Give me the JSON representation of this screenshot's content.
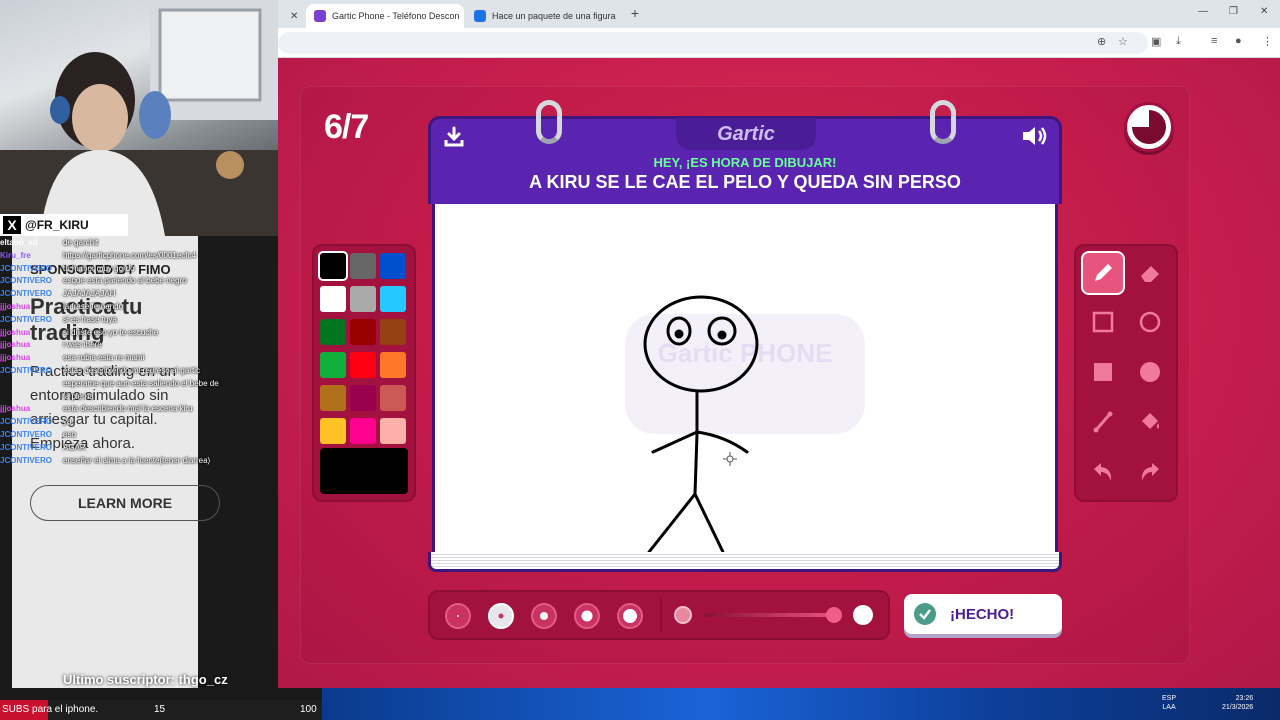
{
  "browser": {
    "tabs": [
      {
        "title": "Gartic Phone - Teléfono Descon",
        "active": true
      },
      {
        "title": "Hace un paquete de una figura",
        "active": false
      }
    ]
  },
  "game": {
    "round": "6/7",
    "logo": "Gartic",
    "prompt_subtitle": "HEY, ¡ES HORA DE DIBUJAR!",
    "prompt_text": "A KIRU SE LE CAE EL PELO Y QUEDA SIN PERSO",
    "done_label": "¡HECHO!",
    "watermark": "Gartic PHONE",
    "palette": [
      "#000000",
      "#666666",
      "#0050cd",
      "#ffffff",
      "#aaaaaa",
      "#26c9ff",
      "#017420",
      "#990000",
      "#964112",
      "#11b03c",
      "#ff0013",
      "#ff7829",
      "#b0701c",
      "#99004e",
      "#cb5a57",
      "#ffc126",
      "#ff008f",
      "#feafa8"
    ],
    "selected_color": "#000000",
    "selected_tool": "pencil",
    "tools": [
      "pencil-icon",
      "eraser-icon",
      "rect-outline-icon",
      "circle-outline-icon",
      "rect-fill-icon",
      "circle-fill-icon",
      "line-icon",
      "fill-bucket-icon",
      "undo-icon",
      "redo-icon"
    ],
    "brush_sizes_selected": 2,
    "opacity": 1.0
  },
  "stream": {
    "handle": "@FR_KIRU",
    "ad": {
      "sponsor": "SPONSORED BY FIMO",
      "title": "Practica tu trading",
      "body": "Practica trading en un entorno simulado sin arriesgar tu capital. Empieza ahora.",
      "cta": "LEARN MORE"
    },
    "chat": [
      {
        "user": "eltano_xd",
        "msg": "de garchit",
        "color": "#ffffff"
      },
      {
        "user": "Kiru_fre",
        "msg": "https://garticphone.com/es/0001ecfc4",
        "color": "#8b5cf6"
      },
      {
        "user": "JCONTIVERO",
        "msg": "tu humor muy gordo",
        "color": "#3b82f6"
      },
      {
        "user": "JCONTIVERO",
        "msg": "esque esta pariendo al bebe negro",
        "color": "#3b82f6"
      },
      {
        "user": "JCONTIVERO",
        "msg": "JAJAJAJAJAH",
        "color": "#3b82f6"
      },
      {
        "user": "jjjoshua",
        "msg": "la frase fernando",
        "color": "#d946ef"
      },
      {
        "user": "JCONTIVERO",
        "msg": "si es frase tuya",
        "color": "#3b82f6"
      },
      {
        "user": "jjjoshua",
        "msg": "si dijiste eso yo te escuche",
        "color": "#d946ef"
      },
      {
        "user": "jjjoshua",
        "msg": "i was there",
        "color": "#d946ef"
      },
      {
        "user": "jjjoshua",
        "msg": "esa rubia esta re mami",
        "color": "#d946ef"
      },
      {
        "user": "JCONTIVERO",
        "msg": "estas describiendo mi regreso al gartic",
        "color": "#3b82f6"
      },
      {
        "user": "",
        "msg": "esperame que aun esta saliendo el bebe de",
        "color": "#3b82f6"
      },
      {
        "user": "",
        "msg": "la pierna",
        "color": "#3b82f6"
      },
      {
        "user": "jjjoshua",
        "msg": "esta describiendo mal la escena kiru",
        "color": "#d946ef"
      },
      {
        "user": "JCONTIVERO",
        "msg": "ya",
        "color": "#3b82f6"
      },
      {
        "user": "JCONTIVERO",
        "msg": "eso",
        "color": "#3b82f6"
      },
      {
        "user": "JCONTIVERO",
        "msg": "AGAR",
        "color": "#3b82f6"
      },
      {
        "user": "JCONTIVERO",
        "msg": "enseñar el alma a la fuente(tener diarrea)",
        "color": "#3b82f6"
      }
    ],
    "last_sub_label": "Ultimo suscriptor:",
    "last_sub_name": "thgo_cz",
    "goal": {
      "text": "SUBS para el iphone.",
      "current": "15",
      "target": "100",
      "progress": 0.15
    }
  },
  "taskbar": {
    "lang": "ESP\nLAA",
    "time": "23:26",
    "date": "21/3/2026"
  }
}
